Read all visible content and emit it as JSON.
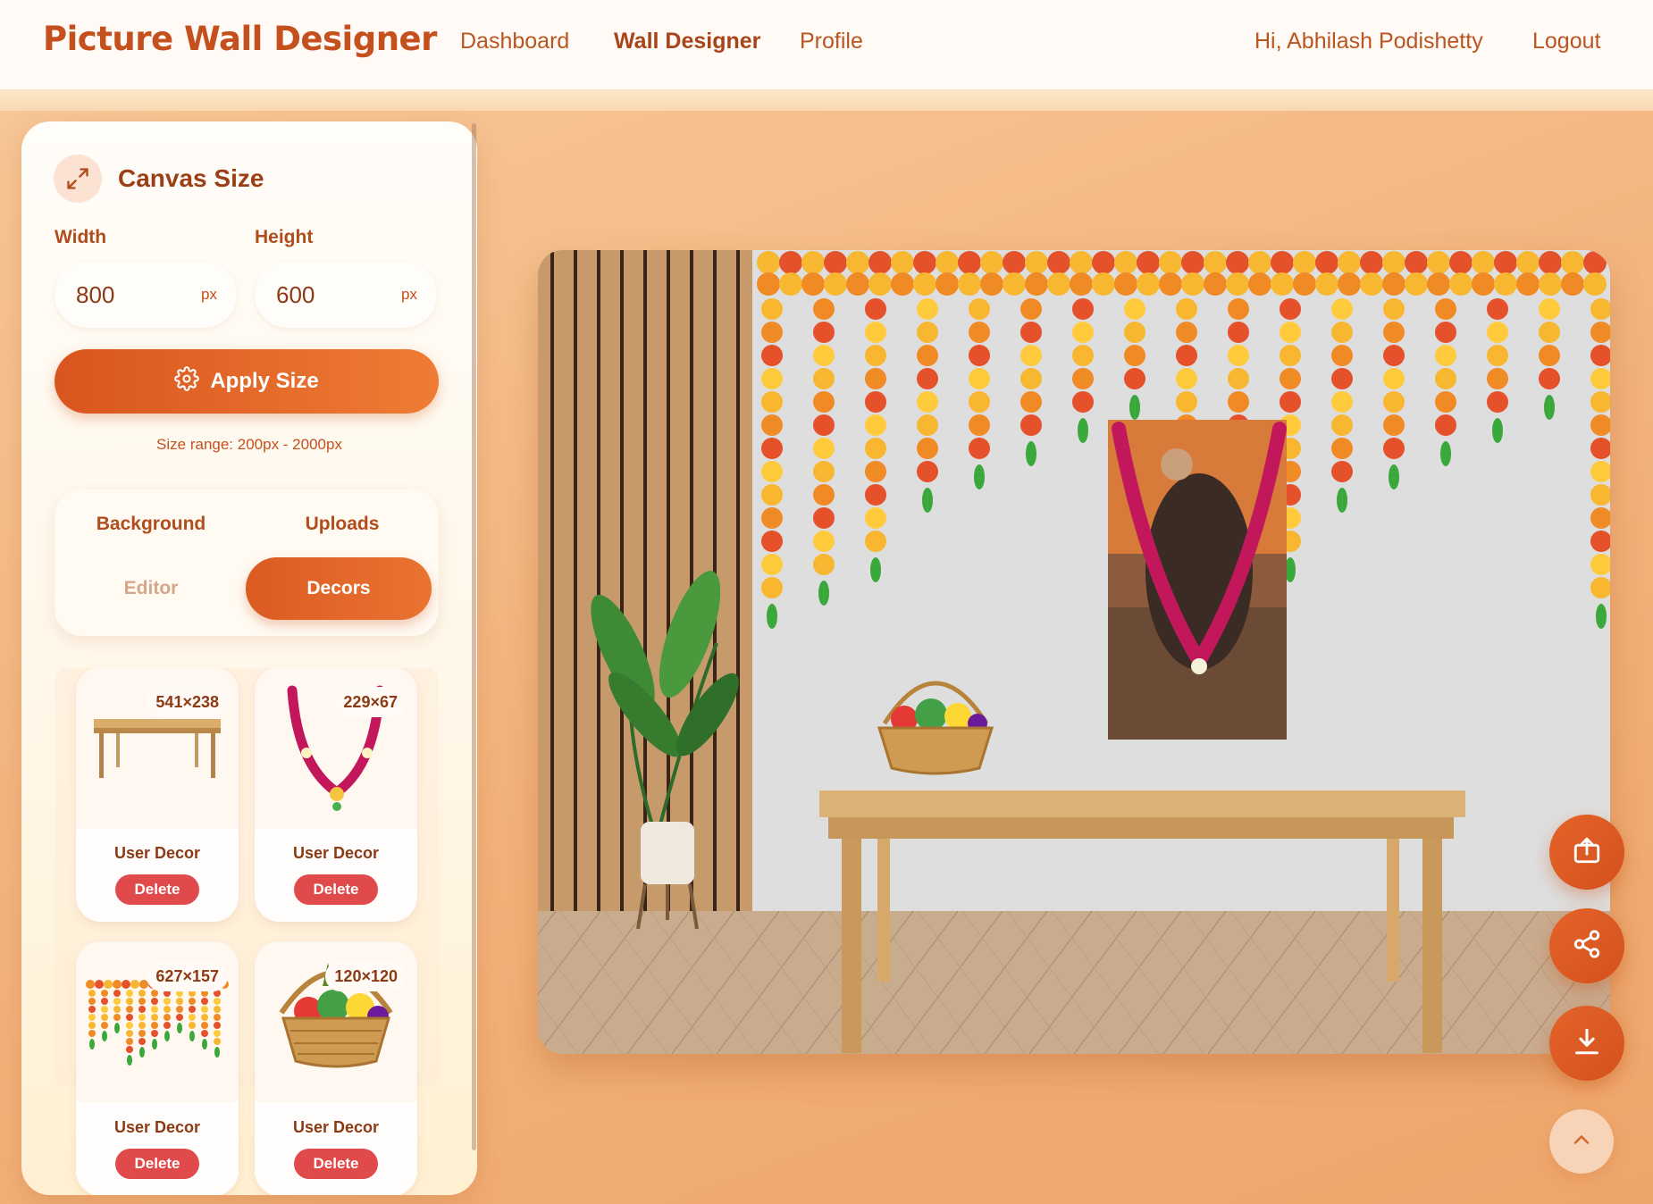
{
  "header": {
    "brand": "Picture Wall Designer",
    "nav": [
      {
        "label": "Dashboard",
        "active": false
      },
      {
        "label": "Wall Designer",
        "active": true
      },
      {
        "label": "Profile",
        "active": false
      }
    ],
    "greeting": "Hi, Abhilash Podishetty",
    "logout": "Logout"
  },
  "canvas_size": {
    "title": "Canvas Size",
    "icon": "expand-icon",
    "width_label": "Width",
    "width_value": "800",
    "height_label": "Height",
    "height_value": "600",
    "unit": "px",
    "apply_label": "Apply Size",
    "apply_icon": "gear-icon",
    "range_note": "Size range: 200px - 2000px"
  },
  "tabs": [
    {
      "label": "Background",
      "state": "normal"
    },
    {
      "label": "Uploads",
      "state": "normal"
    },
    {
      "label": "Editor",
      "state": "muted"
    },
    {
      "label": "Decors",
      "state": "active"
    }
  ],
  "decors": [
    {
      "dims": "541×238",
      "name": "User Decor",
      "action": "Delete",
      "thumb": "table"
    },
    {
      "dims": "229×67",
      "name": "User Decor",
      "action": "Delete",
      "thumb": "garland"
    },
    {
      "dims": "627×157",
      "name": "User Decor",
      "action": "Delete",
      "thumb": "toran"
    },
    {
      "dims": "120×120",
      "name": "User Decor",
      "action": "Delete",
      "thumb": "fruit-basket"
    }
  ],
  "fabs": [
    {
      "name": "export-button",
      "icon": "upload-icon"
    },
    {
      "name": "share-button",
      "icon": "share-icon"
    },
    {
      "name": "download-button",
      "icon": "download-icon"
    },
    {
      "name": "scroll-top-button",
      "icon": "chevron-up-icon"
    }
  ],
  "colors": {
    "brand": "#c4501e",
    "accent": "#e4632a",
    "danger": "#e04a4a",
    "page_bg": "#f3b27a"
  }
}
